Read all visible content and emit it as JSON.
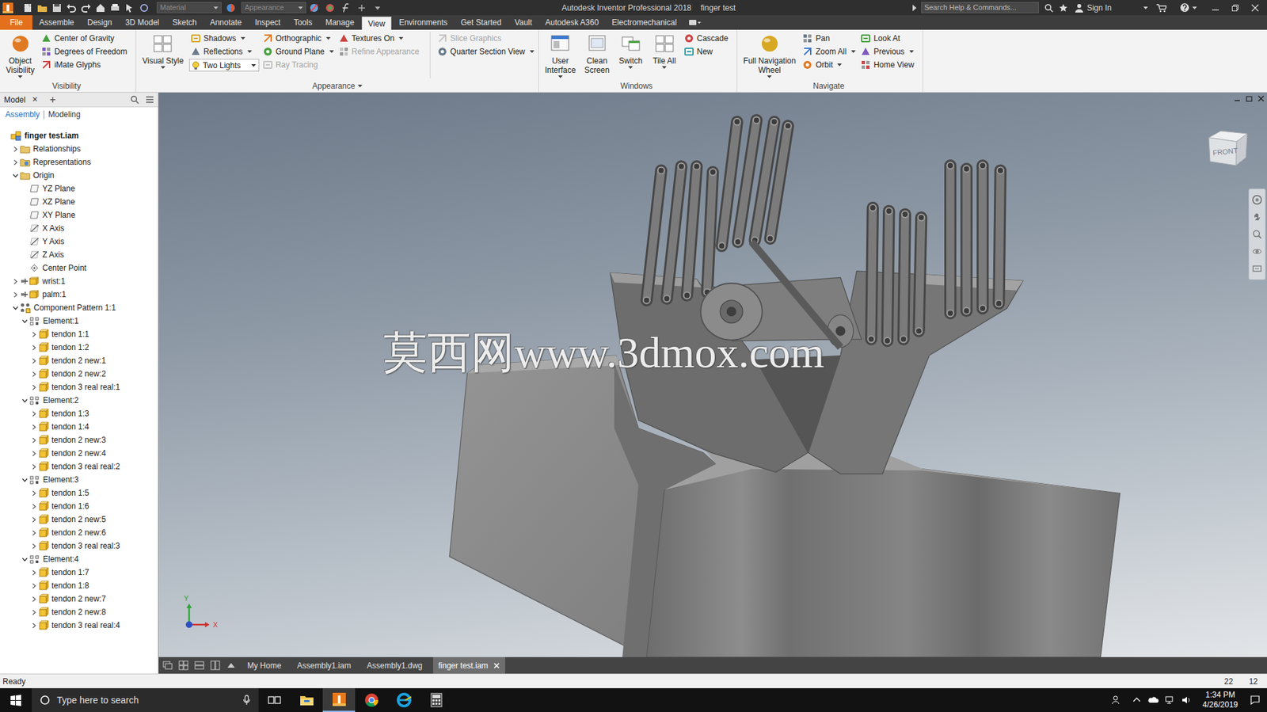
{
  "window": {
    "title": "Autodesk Inventor Professional 2018",
    "document": "finger test"
  },
  "quick_access": {
    "material": {
      "value": "Material",
      "disabled": true
    },
    "appearance": {
      "value": "Appearance",
      "disabled": true
    }
  },
  "search": {
    "placeholder": "Search Help & Commands..."
  },
  "account": {
    "label": "Sign In"
  },
  "menu_tabs": [
    {
      "label": "File",
      "kind": "file",
      "selected": false
    },
    {
      "label": "Assemble",
      "kind": "tab",
      "selected": false
    },
    {
      "label": "Design",
      "kind": "tab",
      "selected": false
    },
    {
      "label": "3D Model",
      "kind": "tab",
      "selected": false
    },
    {
      "label": "Sketch",
      "kind": "tab",
      "selected": false
    },
    {
      "label": "Annotate",
      "kind": "tab",
      "selected": false
    },
    {
      "label": "Inspect",
      "kind": "tab",
      "selected": false
    },
    {
      "label": "Tools",
      "kind": "tab",
      "selected": false
    },
    {
      "label": "Manage",
      "kind": "tab",
      "selected": false
    },
    {
      "label": "View",
      "kind": "tab",
      "selected": true
    },
    {
      "label": "Environments",
      "kind": "tab",
      "selected": false
    },
    {
      "label": "Get Started",
      "kind": "tab",
      "selected": false
    },
    {
      "label": "Vault",
      "kind": "tab",
      "selected": false
    },
    {
      "label": "Autodesk A360",
      "kind": "tab",
      "selected": false
    },
    {
      "label": "Electromechanical",
      "kind": "tab",
      "selected": false
    }
  ],
  "ribbon": {
    "panels": [
      {
        "label": "Visibility",
        "dropdown": false,
        "columns": [
          {
            "separated": false,
            "items": [
              {
                "kind": "large",
                "lines": [
                  "Object",
                  "Visibility"
                ],
                "dropdown": true,
                "disabled": false
              }
            ]
          },
          {
            "separated": false,
            "items": [
              {
                "kind": "small",
                "label": "Center of Gravity",
                "dropdown": false,
                "disabled": false
              },
              {
                "kind": "small",
                "label": "Degrees of Freedom",
                "dropdown": false,
                "disabled": false
              },
              {
                "kind": "small",
                "label": "iMate Glyphs",
                "dropdown": false,
                "disabled": false
              }
            ]
          }
        ]
      },
      {
        "label": "Appearance",
        "dropdown": true,
        "columns": [
          {
            "separated": false,
            "items": [
              {
                "kind": "large",
                "lines": [
                  "Visual Style"
                ],
                "dropdown": true,
                "disabled": false
              }
            ]
          },
          {
            "separated": false,
            "items": [
              {
                "kind": "small",
                "label": "Shadows",
                "dropdown": true,
                "disabled": false
              },
              {
                "kind": "small",
                "label": "Reflections",
                "dropdown": true,
                "disabled": false
              },
              {
                "kind": "combo",
                "label": "Two Lights",
                "dropdown": true,
                "disabled": false
              }
            ]
          },
          {
            "separated": false,
            "items": [
              {
                "kind": "small",
                "label": "Orthographic",
                "dropdown": true,
                "disabled": false
              },
              {
                "kind": "small",
                "label": "Ground Plane",
                "dropdown": true,
                "disabled": false
              },
              {
                "kind": "small",
                "label": "Ray Tracing",
                "dropdown": false,
                "disabled": true
              }
            ]
          },
          {
            "separated": false,
            "items": [
              {
                "kind": "small",
                "label": "Textures On",
                "dropdown": true,
                "disabled": false
              },
              {
                "kind": "small",
                "label": "Refine Appearance",
                "dropdown": false,
                "disabled": true
              }
            ]
          },
          {
            "separated": true,
            "items": [
              {
                "kind": "small",
                "label": "Slice Graphics",
                "dropdown": false,
                "disabled": true
              },
              {
                "kind": "small",
                "label": "Quarter Section View",
                "dropdown": true,
                "disabled": false
              }
            ]
          }
        ]
      },
      {
        "label": "Windows",
        "dropdown": false,
        "columns": [
          {
            "separated": false,
            "items": [
              {
                "kind": "large",
                "lines": [
                  "User",
                  "Interface"
                ],
                "dropdown": true,
                "disabled": false
              }
            ]
          },
          {
            "separated": false,
            "items": [
              {
                "kind": "large",
                "lines": [
                  "Clean",
                  "Screen"
                ],
                "dropdown": false,
                "disabled": false
              }
            ]
          },
          {
            "separated": false,
            "items": [
              {
                "kind": "large",
                "lines": [
                  "Switch"
                ],
                "dropdown": true,
                "disabled": false
              }
            ]
          },
          {
            "separated": false,
            "items": [
              {
                "kind": "large",
                "lines": [
                  "Tile All"
                ],
                "dropdown": true,
                "disabled": false
              }
            ]
          },
          {
            "separated": false,
            "items": [
              {
                "kind": "small",
                "label": "Cascade",
                "dropdown": false,
                "disabled": false
              },
              {
                "kind": "small",
                "label": "New",
                "dropdown": false,
                "disabled": false
              }
            ]
          }
        ]
      },
      {
        "label": "Navigate",
        "dropdown": false,
        "columns": [
          {
            "separated": false,
            "items": [
              {
                "kind": "large",
                "lines": [
                  "Full Navigation",
                  "Wheel"
                ],
                "dropdown": true,
                "disabled": false
              }
            ]
          },
          {
            "separated": false,
            "items": [
              {
                "kind": "small",
                "label": "Pan",
                "dropdown": false,
                "disabled": false
              },
              {
                "kind": "small",
                "label": "Zoom All",
                "dropdown": true,
                "disabled": false
              },
              {
                "kind": "small",
                "label": "Orbit",
                "dropdown": true,
                "disabled": false
              }
            ]
          },
          {
            "separated": false,
            "items": [
              {
                "kind": "small",
                "label": "Look At",
                "dropdown": false,
                "disabled": false
              },
              {
                "kind": "small",
                "label": "Previous",
                "dropdown": true,
                "disabled": false
              },
              {
                "kind": "small",
                "label": "Home View",
                "dropdown": false,
                "disabled": false
              }
            ]
          }
        ]
      }
    ]
  },
  "browser": {
    "title": "Model",
    "close": "×",
    "add": "+",
    "modes": [
      {
        "label": "Assembly",
        "selected": true
      },
      {
        "label": "Modeling",
        "selected": false
      }
    ],
    "tree": [
      {
        "label": "finger test.iam",
        "level": 0,
        "kind": "root",
        "expandable": false
      },
      {
        "label": "Relationships",
        "level": 1,
        "kind": "folder",
        "expandable": true,
        "expanded": false
      },
      {
        "label": "Representations",
        "level": 1,
        "kind": "representations",
        "expandable": true,
        "expanded": false
      },
      {
        "label": "Origin",
        "level": 1,
        "kind": "folder",
        "expandable": true,
        "expanded": true
      },
      {
        "label": "YZ Plane",
        "level": 2,
        "kind": "plane",
        "expandable": false
      },
      {
        "label": "XZ Plane",
        "level": 2,
        "kind": "plane",
        "expandable": false
      },
      {
        "label": "XY Plane",
        "level": 2,
        "kind": "plane",
        "expandable": false
      },
      {
        "label": "X Axis",
        "level": 2,
        "kind": "axis",
        "expandable": false
      },
      {
        "label": "Y Axis",
        "level": 2,
        "kind": "axis",
        "expandable": false
      },
      {
        "label": "Z Axis",
        "level": 2,
        "kind": "axis",
        "expandable": false
      },
      {
        "label": "Center Point",
        "level": 2,
        "kind": "point",
        "expandable": false
      },
      {
        "label": "wrist:1",
        "level": 1,
        "kind": "grounded",
        "expandable": true,
        "expanded": false
      },
      {
        "label": "palm:1",
        "level": 1,
        "kind": "grounded",
        "expandable": true,
        "expanded": false
      },
      {
        "label": "Component Pattern 1:1",
        "level": 1,
        "kind": "pattern",
        "expandable": true,
        "expanded": true
      },
      {
        "label": "Element:1",
        "level": 2,
        "kind": "element",
        "expandable": true,
        "expanded": true
      },
      {
        "label": "tendon 1:1",
        "level": 3,
        "kind": "part",
        "expandable": true,
        "expanded": false
      },
      {
        "label": "tendon 1:2",
        "level": 3,
        "kind": "part",
        "expandable": true,
        "expanded": false
      },
      {
        "label": "tendon 2 new:1",
        "level": 3,
        "kind": "part",
        "expandable": true,
        "expanded": false
      },
      {
        "label": "tendon 2 new:2",
        "level": 3,
        "kind": "part",
        "expandable": true,
        "expanded": false
      },
      {
        "label": "tendon 3 real real:1",
        "level": 3,
        "kind": "part",
        "expandable": true,
        "expanded": false
      },
      {
        "label": "Element:2",
        "level": 2,
        "kind": "element",
        "expandable": true,
        "expanded": true
      },
      {
        "label": "tendon 1:3",
        "level": 3,
        "kind": "part",
        "expandable": true,
        "expanded": false
      },
      {
        "label": "tendon 1:4",
        "level": 3,
        "kind": "part",
        "expandable": true,
        "expanded": false
      },
      {
        "label": "tendon 2 new:3",
        "level": 3,
        "kind": "part",
        "expandable": true,
        "expanded": false
      },
      {
        "label": "tendon 2 new:4",
        "level": 3,
        "kind": "part",
        "expandable": true,
        "expanded": false
      },
      {
        "label": "tendon 3 real real:2",
        "level": 3,
        "kind": "part",
        "expandable": true,
        "expanded": false
      },
      {
        "label": "Element:3",
        "level": 2,
        "kind": "element",
        "expandable": true,
        "expanded": true
      },
      {
        "label": "tendon 1:5",
        "level": 3,
        "kind": "part",
        "expandable": true,
        "expanded": false
      },
      {
        "label": "tendon 1:6",
        "level": 3,
        "kind": "part",
        "expandable": true,
        "expanded": false
      },
      {
        "label": "tendon 2 new:5",
        "level": 3,
        "kind": "part",
        "expandable": true,
        "expanded": false
      },
      {
        "label": "tendon 2 new:6",
        "level": 3,
        "kind": "part",
        "expandable": true,
        "expanded": false
      },
      {
        "label": "tendon 3 real real:3",
        "level": 3,
        "kind": "part",
        "expandable": true,
        "expanded": false
      },
      {
        "label": "Element:4",
        "level": 2,
        "kind": "element",
        "expandable": true,
        "expanded": true
      },
      {
        "label": "tendon 1:7",
        "level": 3,
        "kind": "part",
        "expandable": true,
        "expanded": false
      },
      {
        "label": "tendon 1:8",
        "level": 3,
        "kind": "part",
        "expandable": true,
        "expanded": false
      },
      {
        "label": "tendon 2 new:7",
        "level": 3,
        "kind": "part",
        "expandable": true,
        "expanded": false
      },
      {
        "label": "tendon 2 new:8",
        "level": 3,
        "kind": "part",
        "expandable": true,
        "expanded": false
      },
      {
        "label": "tendon 3 real real:4",
        "level": 3,
        "kind": "part",
        "expandable": true,
        "expanded": false
      }
    ]
  },
  "viewport": {
    "viewcube": "FRONT",
    "triad": {
      "y": "Y",
      "x": "X"
    },
    "watermark": "莫西网www.3dmox.com"
  },
  "document_tabs": [
    {
      "label": "My Home",
      "selected": false,
      "closable": false
    },
    {
      "label": "Assembly1.iam",
      "selected": false,
      "closable": false
    },
    {
      "label": "Assembly1.dwg",
      "selected": false,
      "closable": false
    },
    {
      "label": "finger test.iam",
      "selected": true,
      "closable": true
    }
  ],
  "status_bar": {
    "message": "Ready",
    "counts": [
      "22",
      "12"
    ]
  },
  "taskbar": {
    "search_placeholder": "Type here to search",
    "time": "1:34 PM",
    "date": "4/26/2019",
    "apps": [
      {
        "kind": "explorer",
        "active": false
      },
      {
        "kind": "inventor",
        "active": true
      },
      {
        "kind": "chrome",
        "active": false
      },
      {
        "kind": "edge",
        "active": false
      },
      {
        "kind": "calculator",
        "active": false
      }
    ]
  }
}
